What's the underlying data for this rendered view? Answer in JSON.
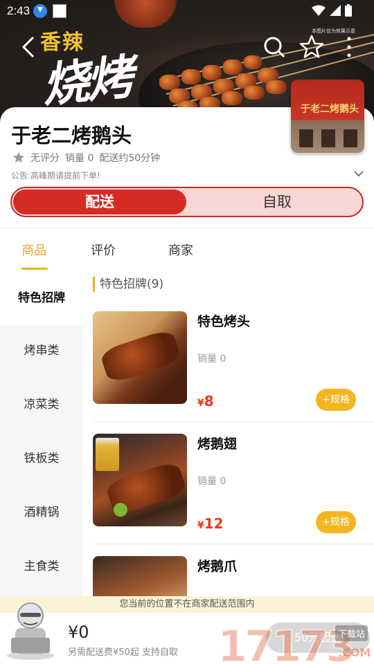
{
  "status_bar": {
    "time": "2:43"
  },
  "banner": {
    "slogan_top": "香辣",
    "slogan_main": "烧烤",
    "fine_print": "本图片仅为效果示意"
  },
  "shop": {
    "name": "于老二烤鹅头",
    "rating": "无评分",
    "sales": "销量 0",
    "delivery_time": "配送约50分钟",
    "notice": "公告:高峰期请提前下单!",
    "photo_sign": "于老二烤鹅头"
  },
  "mode_toggle": {
    "delivery": "配送",
    "pickup": "自取"
  },
  "tabs": [
    {
      "label": "商品"
    },
    {
      "label": "评价"
    },
    {
      "label": "商家"
    }
  ],
  "categories": [
    {
      "label": "特色招牌"
    },
    {
      "label": "烤串类"
    },
    {
      "label": "凉菜类"
    },
    {
      "label": "铁板类"
    },
    {
      "label": "酒精锅"
    },
    {
      "label": "主食类"
    }
  ],
  "section": {
    "title": "特色招牌(9)"
  },
  "products": [
    {
      "name": "特色烤头",
      "sales": "销量 0",
      "currency": "¥",
      "price": "8",
      "spec_button": "+规格"
    },
    {
      "name": "烤鹅翅",
      "sales": "销量 0",
      "currency": "¥",
      "price": "12",
      "spec_button": "+规格"
    },
    {
      "name": "烤鹅爪"
    }
  ],
  "range_notice": "您当前的位置不在商家配送范围内",
  "cart": {
    "total": "¥0",
    "hint": "另需配送费¥50起  支持自取",
    "checkout": "50元起送"
  },
  "watermark": {
    "brand": "17173",
    "badge": "下载站",
    "domain": ".COM"
  },
  "colors": {
    "accent_red": "#d62b24",
    "accent_yellow": "#f3b61e",
    "price_red": "#ec3a1a"
  }
}
